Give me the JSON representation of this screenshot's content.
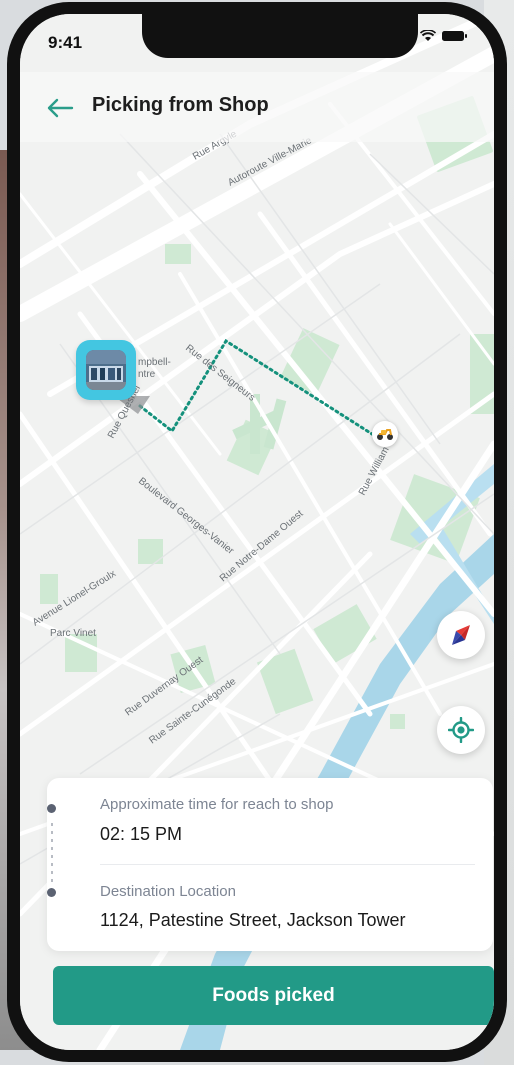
{
  "status_bar": {
    "time": "9:41"
  },
  "header": {
    "title": "Picking from Shop",
    "back_icon": "arrow-left-icon"
  },
  "map": {
    "street_labels": [
      "Rue Argyle",
      "Autoroute Ville-Marie",
      "Rue des Seigneurs",
      "Rue Quesnel",
      "Boulevard Georges-Vanier",
      "Rue Notre-Dame Ouest",
      "Rue William",
      "Avenue Lionel-Groulx",
      "Parc Vinet",
      "Rue Duvernay Ouest",
      "Rue Sainte-Cunégonde",
      "mpbell-",
      "ntre"
    ],
    "colors": {
      "route": "#14917c",
      "water": "#a9d6e9",
      "park": "#c7e7cf"
    }
  },
  "info": {
    "pickup_label": "Approximate time for reach to shop",
    "pickup_value": "02: 15 PM",
    "destination_label": "Destination Location",
    "destination_value": "1124, Patestine Street, Jackson Tower"
  },
  "actions": {
    "primary_label": "Foods picked"
  },
  "colors": {
    "accent": "#229a87",
    "marker": "#43c6e1"
  }
}
